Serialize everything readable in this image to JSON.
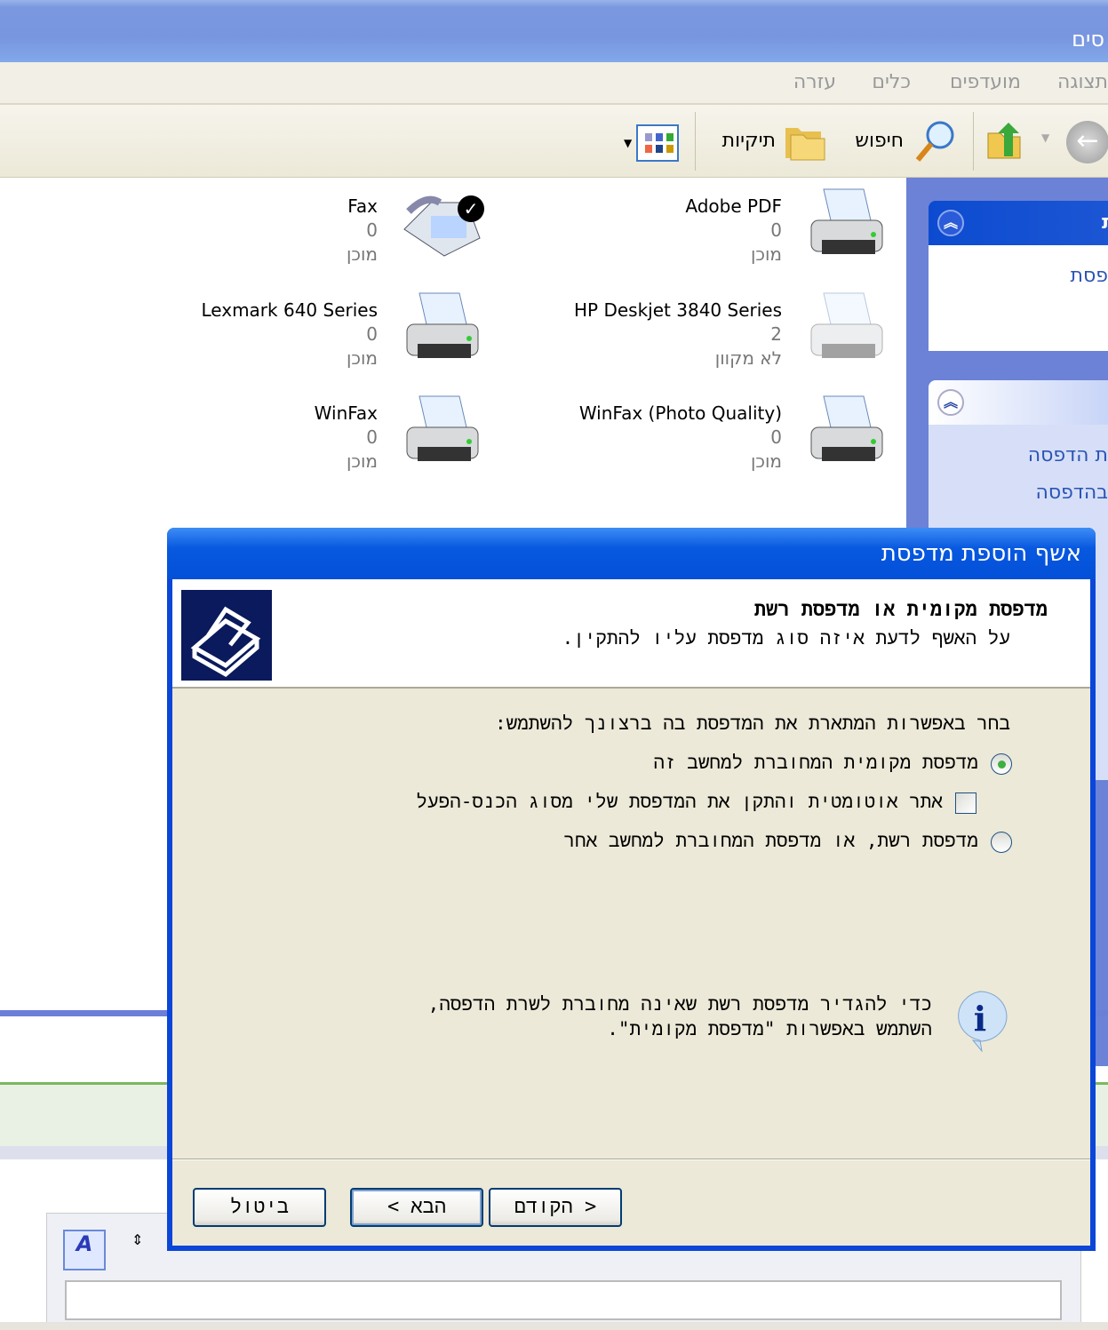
{
  "window": {
    "title_partial": "סים"
  },
  "menu": [
    "תצוגה",
    "מועדפים",
    "כלים",
    "עזרה"
  ],
  "toolbar": {
    "search": "חיפוש",
    "folders": "תיקיות"
  },
  "sidebar": {
    "panel1": {
      "title_partial": "ת",
      "link": "פסת"
    },
    "panel2": {
      "links": [
        "ת הדפסה",
        "בהדפסה"
      ]
    }
  },
  "printers": [
    {
      "name": "Adobe PDF",
      "count": "0",
      "status": "מוכן"
    },
    {
      "name": "Fax",
      "count": "0",
      "status": "מוכן",
      "default": true
    },
    {
      "name": "HP Deskjet 3840 Series",
      "count": "2",
      "status": "לא מקוון"
    },
    {
      "name": "Lexmark 640 Series",
      "count": "0",
      "status": "מוכן"
    },
    {
      "name": "WinFax (Photo Quality)",
      "count": "0",
      "status": "מוכן"
    },
    {
      "name": "WinFax",
      "count": "0",
      "status": "מוכן"
    }
  ],
  "dialog": {
    "title": "אשף הוספת מדפסת",
    "heading": "מדפסת מקומית או מדפסת רשת",
    "subheading": "על האשף לדעת איזה סוג מדפסת עליו להתקין.",
    "prompt": "בחר באפשרות המתארת את המדפסת בה ברצונך להשתמש:",
    "option_local": "מדפסת מקומית המחוברת למחשב זה",
    "option_auto": "אתר אוטומטית והתקן את המדפסת שלי מסוג הכנס-הפעל",
    "option_network": "מדפסת רשת, או מדפסת המחוברת למחשב אחר",
    "info_line1": "כדי להגדיר מדפסת רשת שאינה מחוברת לשרת הדפסה,",
    "info_line2": "השתמש באפשרות \"מדפסת מקומית\".",
    "back": "< הקודם",
    "next": "הבא >",
    "cancel": "ביטול",
    "selected_option": "local",
    "auto_detect_checked": false
  }
}
